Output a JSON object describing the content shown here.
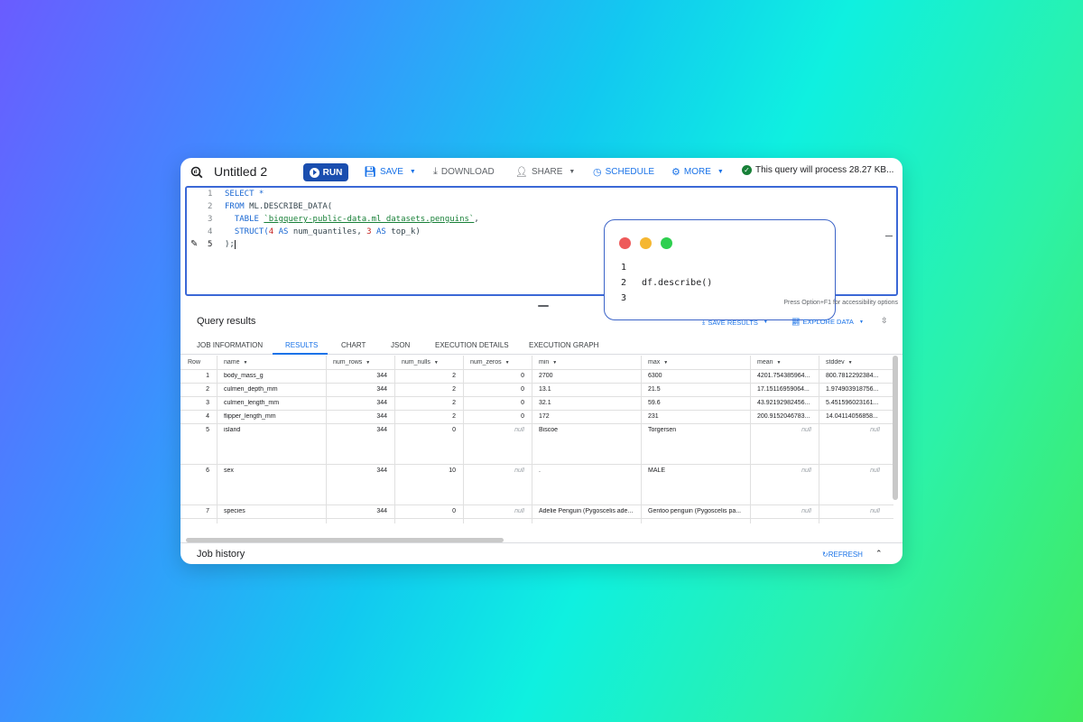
{
  "toolbar": {
    "title": "Untitled 2",
    "run_label": "RUN",
    "save_label": "SAVE",
    "download_label": "DOWNLOAD",
    "share_label": "SHARE",
    "schedule_label": "SCHEDULE",
    "more_label": "MORE",
    "status": "This query will process 28.27 KB..."
  },
  "editor": {
    "line_numbers": [
      "1",
      "2",
      "3",
      "4",
      "5"
    ],
    "lines": {
      "l1_kw": "SELECT *",
      "l2_kw": "FROM ",
      "l2_rest": "ML.DESCRIBE_DATA(",
      "l3_kw": "TABLE ",
      "l3_str": "`bigquery-public-data.ml_datasets.penguins`",
      "l3_end": ",",
      "l4_kw1": "STRUCT(",
      "l4_n1": "4",
      "l4_kw2": " AS",
      "l4_mid": " num_quantiles, ",
      "l4_n2": "3",
      "l4_kw3": " AS",
      "l4_end": " top_k)",
      "l5": ");"
    },
    "accessibility_note": "Press Option+F1 for accessibility options"
  },
  "notebook_card": {
    "colors": {
      "red": "#ee5a5a",
      "yellow": "#f5b731",
      "green": "#2ecf4f"
    },
    "line_numbers": [
      "1",
      "2",
      "3"
    ],
    "code": "df.describe()"
  },
  "results": {
    "title": "Query results",
    "save_results_label": "SAVE RESULTS",
    "explore_data_label": "EXPLORE DATA",
    "tabs": [
      "JOB INFORMATION",
      "RESULTS",
      "CHART",
      "JSON",
      "EXECUTION DETAILS",
      "EXECUTION GRAPH"
    ],
    "active_tab": "RESULTS",
    "columns": [
      "Row",
      "name",
      "num_rows",
      "num_nulls",
      "num_zeros",
      "min",
      "max",
      "mean",
      "stddev"
    ],
    "rows": [
      {
        "row": "1",
        "name": "body_mass_g",
        "num_rows": "344",
        "num_nulls": "2",
        "num_zeros": "0",
        "min": "2700",
        "max": "6300",
        "mean": "4201.754385964...",
        "stddev": "800.7812292384..."
      },
      {
        "row": "2",
        "name": "culmen_depth_mm",
        "num_rows": "344",
        "num_nulls": "2",
        "num_zeros": "0",
        "min": "13.1",
        "max": "21.5",
        "mean": "17.15116959064...",
        "stddev": "1.974903918756..."
      },
      {
        "row": "3",
        "name": "culmen_length_mm",
        "num_rows": "344",
        "num_nulls": "2",
        "num_zeros": "0",
        "min": "32.1",
        "max": "59.6",
        "mean": "43.92192982456...",
        "stddev": "5.451596023161..."
      },
      {
        "row": "4",
        "name": "flipper_length_mm",
        "num_rows": "344",
        "num_nulls": "2",
        "num_zeros": "0",
        "min": "172",
        "max": "231",
        "mean": "200.9152046783...",
        "stddev": "14.04114056858..."
      },
      {
        "row": "5",
        "name": "island",
        "num_rows": "344",
        "num_nulls": "0",
        "num_zeros": "null",
        "min": "Biscoe",
        "max": "Torgersen",
        "mean": "null",
        "stddev": "null"
      },
      {
        "row": "6",
        "name": "sex",
        "num_rows": "344",
        "num_nulls": "10",
        "num_zeros": "null",
        "min": ".",
        "max": "MALE",
        "mean": "null",
        "stddev": "null"
      },
      {
        "row": "7",
        "name": "species",
        "num_rows": "344",
        "num_nulls": "0",
        "num_zeros": "null",
        "min": "Adelie Penguin (Pygoscelis ade...",
        "max": "Gentoo penguin (Pygoscelis pa...",
        "mean": "null",
        "stddev": "null"
      }
    ]
  },
  "job_history": {
    "title": "Job history",
    "refresh_label": "REFRESH"
  }
}
